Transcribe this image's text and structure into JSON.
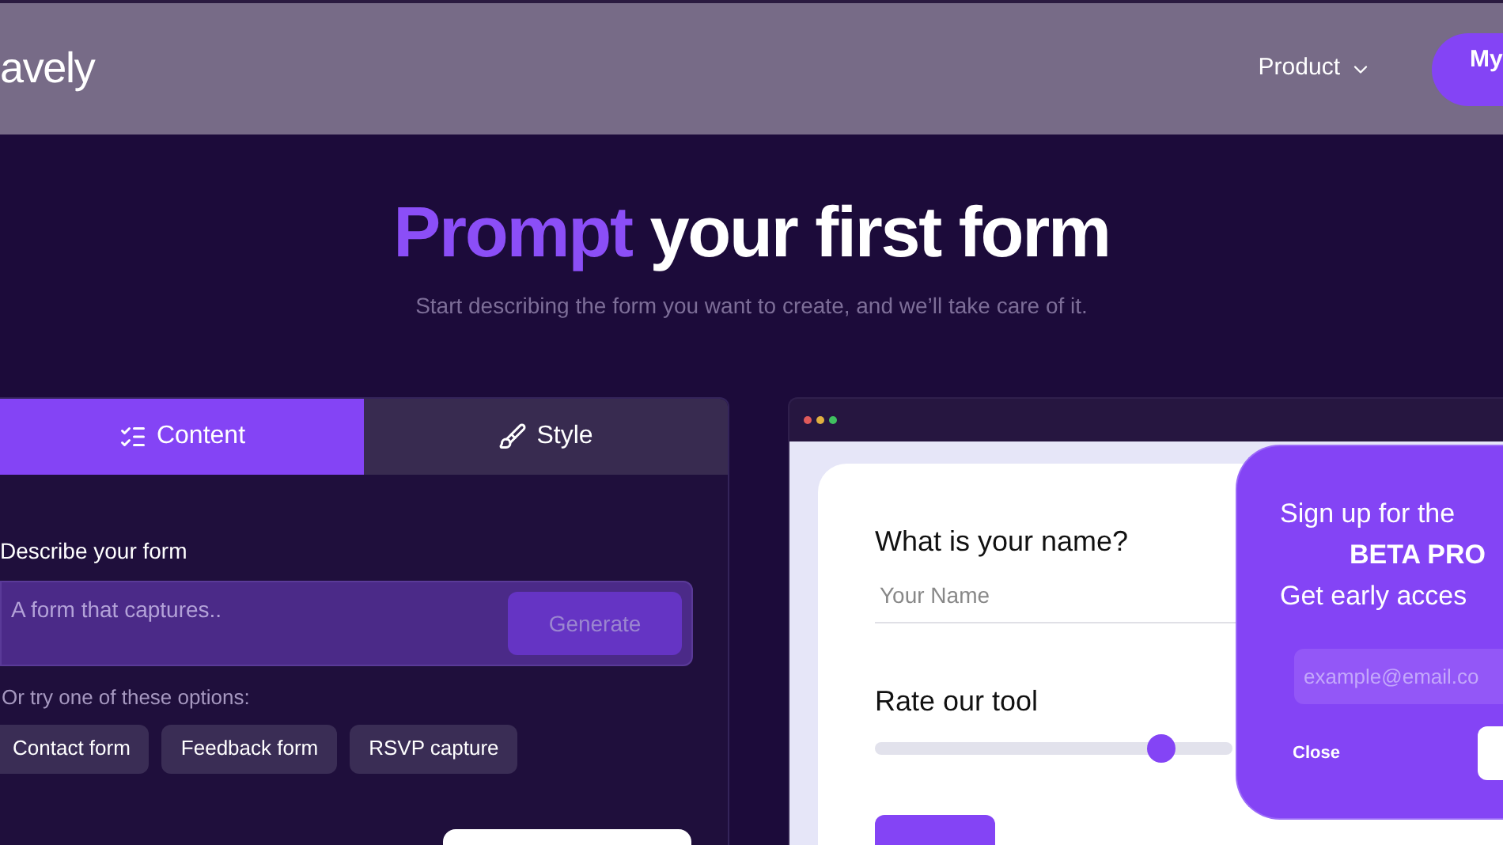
{
  "nav": {
    "logo": "avely",
    "menu": [
      {
        "label": "Product"
      }
    ],
    "cta": "My"
  },
  "hero": {
    "highlight": "Prompt",
    "rest": "your first form",
    "subtitle": "Start describing the form you want to create, and we’ll take care of it."
  },
  "editor": {
    "tabs": [
      {
        "label": "Content",
        "kind": "list",
        "selected": true
      },
      {
        "label": "Style",
        "kind": "brush",
        "selected": false
      }
    ],
    "label": "Describe your form",
    "placeholder": "A form that captures..",
    "generate": "Generate",
    "options_label": "Or try one of these options:",
    "options": [
      "Contact form",
      "Feedback form",
      "RSVP capture"
    ]
  },
  "preview": {
    "question": "What is your name?",
    "name_placeholder": "Your Name",
    "rate_label": "Rate our tool",
    "rating": {
      "level": 0.8
    },
    "popup": {
      "line_1": "Sign up for the",
      "line_2": "BETA PRO",
      "line_3": "Get early acces",
      "email_placeholder": "example@email.co",
      "close": "Close"
    }
  }
}
